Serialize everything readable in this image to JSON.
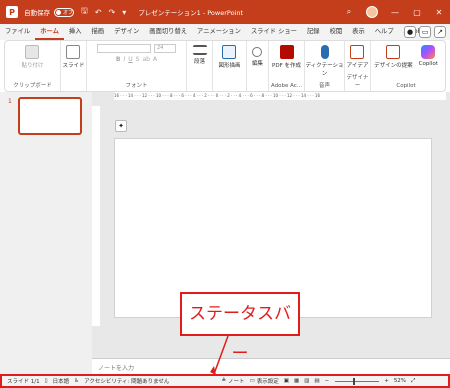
{
  "titlebar": {
    "logo": "P",
    "autosave_label": "自動保存",
    "autosave_state": "オフ",
    "title": "プレゼンテーション1 - PowerPoint",
    "icons": [
      "save-icon",
      "undo-icon",
      "redo-icon",
      "customize-icon"
    ],
    "right_icons": [
      "search-icon",
      "minimize-icon",
      "maximize-icon",
      "close-icon"
    ],
    "accent_color": "#c43e1c"
  },
  "tabs": [
    "ファイル",
    "ホーム",
    "挿入",
    "描画",
    "デザイン",
    "画面切り替え",
    "アニメーション",
    "スライド ショー",
    "記録",
    "校閲",
    "表示",
    "ヘルプ",
    "Acrobat"
  ],
  "active_tab": 1,
  "ribbon": {
    "paste": "貼り付け",
    "clipboard": "クリップボード",
    "slide": "スライド",
    "font_size": "24",
    "font": "フォント",
    "paragraph": "段落",
    "shapes": "図形描画",
    "edit": "編集",
    "pdf": "PDF を作成",
    "adobe": "Adobe Ac...",
    "dictate": "ディクテーション",
    "voice": "音声",
    "designer": "デザイナー",
    "design_label": "アイデア",
    "design_idea": "デザインの提案",
    "copilot": "Copilot",
    "group_design": "デザイナー"
  },
  "slides_pane": {
    "slide_number": "1"
  },
  "notes_placeholder": "ノートを入力",
  "callout": "ステータスバー",
  "status": {
    "slide": "スライド 1/1",
    "language": "日本語",
    "accessibility": "アクセシビリティ: 問題ありません",
    "notes": "ノート",
    "display": "表示設定",
    "zoom": "52%"
  },
  "ruler_text": "16 · · · 14 · · · 12 · · · 10 · · · 8 · · · 6 · · · 4 · · · 2 · · · 0 · · · 2 · · · 4 · · · 6 · · · 8 · · · 10 · · · 12 · · · 14 · · · 16"
}
